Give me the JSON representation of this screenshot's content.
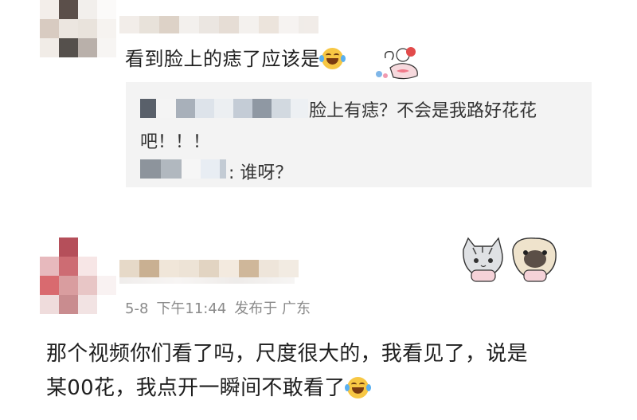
{
  "comment_top": {
    "text": "看到脸上的痣了应该是",
    "emoji": "laughing-with-tears-icon",
    "sticker": "cat-with-fish-sticker"
  },
  "reply_thread": {
    "reply_1_text": "脸上有痣？不会是我路好花花",
    "reply_1_cont": "吧！！！",
    "reply_2_text": ": 谁呀？"
  },
  "comment_main": {
    "stickers": [
      "cat-sticker",
      "pug-sticker"
    ],
    "date": "5-8",
    "time": "下午11:44",
    "location": "发布于 广东",
    "line1": "那个视频你们看了吗，尺度很大的，我看见了，说是",
    "line2": "某00花，我点开一瞬间不敢看了",
    "emoji": "laughing-with-tears-icon"
  },
  "colors": {
    "reply_bg": "#f3f3f3",
    "meta_gray": "#8a8a8a",
    "emoji_yellow": "#f7c744"
  }
}
